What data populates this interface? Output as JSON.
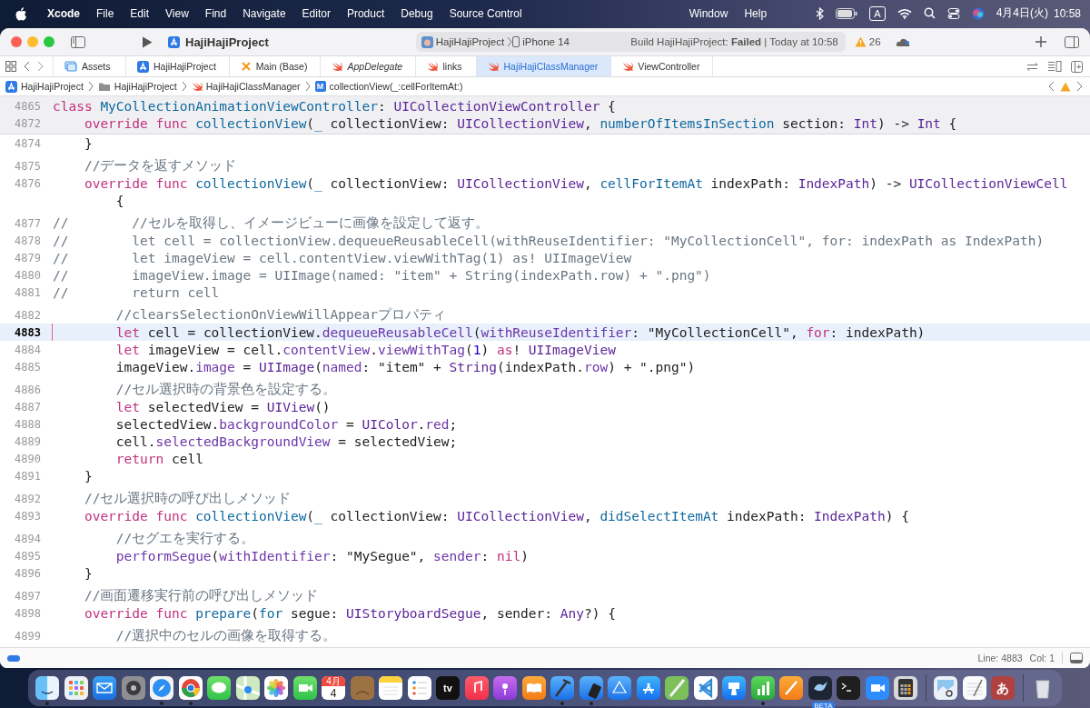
{
  "menu_bar": {
    "app": "Xcode",
    "menus": [
      "File",
      "Edit",
      "View",
      "Find",
      "Navigate",
      "Editor",
      "Product",
      "Debug",
      "Source Control"
    ],
    "menus_past_notch": [
      "Window",
      "Help"
    ],
    "input_source": "A",
    "date": "4月4日(火)",
    "time": "10:58"
  },
  "toolbar": {
    "project": "HajiHajiProject",
    "scheme": "HajiHajiProject",
    "device": "iPhone 14",
    "build_status": "Build HajiHajiProject: **Failed** | Today at 10:58",
    "warnings": "26"
  },
  "tabs": [
    {
      "label": "Assets",
      "kind": "assets",
      "selected": false,
      "preview": false
    },
    {
      "label": "HajiHajiProject",
      "kind": "project",
      "selected": false,
      "preview": false
    },
    {
      "label": "Main (Base)",
      "kind": "storyboard",
      "selected": false,
      "preview": false
    },
    {
      "label": "AppDelegate",
      "kind": "swift",
      "selected": false,
      "preview": true
    },
    {
      "label": "links",
      "kind": "swift",
      "selected": false,
      "preview": false
    },
    {
      "label": "HajiHajiClassManager",
      "kind": "swift",
      "selected": true,
      "preview": false
    },
    {
      "label": "ViewController",
      "kind": "swift",
      "selected": false,
      "preview": false
    }
  ],
  "breadcrumb": [
    {
      "label": "HajiHajiProject",
      "kind": "project"
    },
    {
      "label": "HajiHajiProject",
      "kind": "folder"
    },
    {
      "label": "HajiHajiClassManager",
      "kind": "swift"
    },
    {
      "label": "collectionView(_:cellForItemAt:)",
      "kind": "method",
      "badge": "M"
    }
  ],
  "editor": {
    "sticky_lines": [
      {
        "number": "4865",
        "tokens": [
          {
            "kind": "kw",
            "text": "class "
          },
          {
            "kind": "decl",
            "text": "MyCollectionAnimationViewController"
          },
          {
            "kind": "plain",
            "text": ": "
          },
          {
            "kind": "type",
            "text": "UICollectionViewController"
          },
          {
            "kind": "plain",
            "text": " {"
          }
        ]
      },
      {
        "number": "4872",
        "tokens": [
          {
            "kind": "kw",
            "text": "    override func "
          },
          {
            "kind": "decl",
            "text": "collectionView"
          },
          {
            "kind": "plain",
            "text": "("
          },
          {
            "kind": "decl",
            "text": "_"
          },
          {
            "kind": "plain",
            "text": " collectionView: "
          },
          {
            "kind": "type",
            "text": "UICollectionView"
          },
          {
            "kind": "plain",
            "text": ", "
          },
          {
            "kind": "decl",
            "text": "numberOfItemsInSection"
          },
          {
            "kind": "plain",
            "text": " section: "
          },
          {
            "kind": "type",
            "text": "Int"
          },
          {
            "kind": "plain",
            "text": ") -> "
          },
          {
            "kind": "type",
            "text": "Int"
          },
          {
            "kind": "plain",
            "text": " {"
          }
        ]
      }
    ],
    "blocks": [
      {
        "lines": [
          {
            "number": "4874",
            "current": false,
            "tokens": [
              {
                "kind": "plain",
                "text": "    }"
              }
            ]
          }
        ]
      },
      {
        "lines": [
          {
            "number": "4875",
            "current": false,
            "tokens": [
              {
                "kind": "com",
                "text": "    //データを返すメソッド"
              }
            ]
          },
          {
            "number": "4876",
            "current": false,
            "tokens": [
              {
                "kind": "kw",
                "text": "    override func "
              },
              {
                "kind": "decl",
                "text": "collectionView"
              },
              {
                "kind": "plain",
                "text": "("
              },
              {
                "kind": "decl",
                "text": "_"
              },
              {
                "kind": "plain",
                "text": " collectionView: "
              },
              {
                "kind": "type",
                "text": "UICollectionView"
              },
              {
                "kind": "plain",
                "text": ", "
              },
              {
                "kind": "decl",
                "text": "cellForItemAt"
              },
              {
                "kind": "plain",
                "text": " indexPath: "
              },
              {
                "kind": "type",
                "text": "IndexPath"
              },
              {
                "kind": "plain",
                "text": ") -> "
              },
              {
                "kind": "type",
                "text": "UICollectionViewCell"
              }
            ],
            "wrap": [
              {
                "kind": "plain",
                "text": "        {"
              }
            ]
          }
        ]
      },
      {
        "lines": [
          {
            "number": "4877",
            "current": false,
            "tokens": [
              {
                "kind": "com",
                "text": "//        //セルを取得し、イメージビューに画像を設定して返す。"
              }
            ]
          },
          {
            "number": "4878",
            "current": false,
            "tokens": [
              {
                "kind": "com",
                "text": "//        let cell = collectionView.dequeueReusableCell(withReuseIdentifier: \"MyCollectionCell\", for: indexPath as IndexPath)"
              }
            ]
          },
          {
            "number": "4879",
            "current": false,
            "tokens": [
              {
                "kind": "com",
                "text": "//        let imageView = cell.contentView.viewWithTag(1) as! UIImageView"
              }
            ]
          },
          {
            "number": "4880",
            "current": false,
            "tokens": [
              {
                "kind": "com",
                "text": "//        imageView.image = UIImage(named: \"item\" + String(indexPath.row) + \".png\")"
              }
            ]
          },
          {
            "number": "4881",
            "current": false,
            "tokens": [
              {
                "kind": "com",
                "text": "//        return cell"
              }
            ]
          }
        ]
      },
      {
        "lines": [
          {
            "number": "4882",
            "current": false,
            "tokens": [
              {
                "kind": "com",
                "text": "        //clearsSelectionOnViewWillAppearプロパティ"
              }
            ]
          },
          {
            "number": "4883",
            "current": true,
            "tokens": [
              {
                "kind": "kw",
                "text": "        let"
              },
              {
                "kind": "plain",
                "text": " cell = collectionView."
              },
              {
                "kind": "mem",
                "text": "dequeueReusableCell"
              },
              {
                "kind": "plain",
                "text": "("
              },
              {
                "kind": "mem",
                "text": "withReuseIdentifier"
              },
              {
                "kind": "plain",
                "text": ": \"MyCollectionCell\", "
              },
              {
                "kind": "kw",
                "text": "for"
              },
              {
                "kind": "plain",
                "text": ": indexPath)"
              }
            ]
          },
          {
            "number": "4884",
            "current": false,
            "tokens": [
              {
                "kind": "kw",
                "text": "        let"
              },
              {
                "kind": "plain",
                "text": " imageView = cell."
              },
              {
                "kind": "mem",
                "text": "contentView"
              },
              {
                "kind": "plain",
                "text": "."
              },
              {
                "kind": "mem",
                "text": "viewWithTag"
              },
              {
                "kind": "plain",
                "text": "("
              },
              {
                "kind": "num",
                "text": "1"
              },
              {
                "kind": "plain",
                "text": ") "
              },
              {
                "kind": "kw",
                "text": "as"
              },
              {
                "kind": "plain",
                "text": "! "
              },
              {
                "kind": "type",
                "text": "UIImageView"
              }
            ]
          },
          {
            "number": "4885",
            "current": false,
            "tokens": [
              {
                "kind": "plain",
                "text": "        imageView."
              },
              {
                "kind": "mem",
                "text": "image"
              },
              {
                "kind": "plain",
                "text": " = "
              },
              {
                "kind": "type",
                "text": "UIImage"
              },
              {
                "kind": "plain",
                "text": "("
              },
              {
                "kind": "mem",
                "text": "named"
              },
              {
                "kind": "plain",
                "text": ": \"item\" + "
              },
              {
                "kind": "type",
                "text": "String"
              },
              {
                "kind": "plain",
                "text": "(indexPath."
              },
              {
                "kind": "mem",
                "text": "row"
              },
              {
                "kind": "plain",
                "text": ") + \".png\")"
              }
            ]
          }
        ]
      },
      {
        "lines": [
          {
            "number": "4886",
            "current": false,
            "tokens": [
              {
                "kind": "com",
                "text": "        //セル選択時の背景色を設定する。"
              }
            ]
          },
          {
            "number": "4887",
            "current": false,
            "tokens": [
              {
                "kind": "kw",
                "text": "        let"
              },
              {
                "kind": "plain",
                "text": " selectedView = "
              },
              {
                "kind": "type",
                "text": "UIView"
              },
              {
                "kind": "plain",
                "text": "()"
              }
            ]
          },
          {
            "number": "4888",
            "current": false,
            "tokens": [
              {
                "kind": "plain",
                "text": "        selectedView."
              },
              {
                "kind": "mem",
                "text": "backgroundColor"
              },
              {
                "kind": "plain",
                "text": " = "
              },
              {
                "kind": "type",
                "text": "UIColor"
              },
              {
                "kind": "plain",
                "text": "."
              },
              {
                "kind": "mem",
                "text": "red"
              },
              {
                "kind": "plain",
                "text": ";"
              }
            ]
          },
          {
            "number": "4889",
            "current": false,
            "tokens": [
              {
                "kind": "plain",
                "text": "        cell."
              },
              {
                "kind": "mem",
                "text": "selectedBackgroundView"
              },
              {
                "kind": "plain",
                "text": " = selectedView;"
              }
            ]
          },
          {
            "number": "4890",
            "current": false,
            "tokens": [
              {
                "kind": "kw",
                "text": "        return"
              },
              {
                "kind": "plain",
                "text": " cell"
              }
            ]
          },
          {
            "number": "4891",
            "current": false,
            "tokens": [
              {
                "kind": "plain",
                "text": "    }"
              }
            ]
          }
        ]
      },
      {
        "lines": [
          {
            "number": "4892",
            "current": false,
            "tokens": [
              {
                "kind": "com",
                "text": "    //セル選択時の呼び出しメソッド"
              }
            ]
          },
          {
            "number": "4893",
            "current": false,
            "tokens": [
              {
                "kind": "kw",
                "text": "    override func "
              },
              {
                "kind": "decl",
                "text": "collectionView"
              },
              {
                "kind": "plain",
                "text": "("
              },
              {
                "kind": "decl",
                "text": "_"
              },
              {
                "kind": "plain",
                "text": " collectionView: "
              },
              {
                "kind": "type",
                "text": "UICollectionView"
              },
              {
                "kind": "plain",
                "text": ", "
              },
              {
                "kind": "decl",
                "text": "didSelectItemAt"
              },
              {
                "kind": "plain",
                "text": " indexPath: "
              },
              {
                "kind": "type",
                "text": "IndexPath"
              },
              {
                "kind": "plain",
                "text": ") {"
              }
            ]
          }
        ]
      },
      {
        "lines": [
          {
            "number": "4894",
            "current": false,
            "tokens": [
              {
                "kind": "com",
                "text": "        //セグエを実行する。"
              }
            ]
          },
          {
            "number": "4895",
            "current": false,
            "tokens": [
              {
                "kind": "mem",
                "text": "        performSegue"
              },
              {
                "kind": "plain",
                "text": "("
              },
              {
                "kind": "mem",
                "text": "withIdentifier"
              },
              {
                "kind": "plain",
                "text": ": \"MySegue\", "
              },
              {
                "kind": "mem",
                "text": "sender"
              },
              {
                "kind": "plain",
                "text": ": "
              },
              {
                "kind": "kw",
                "text": "nil"
              },
              {
                "kind": "plain",
                "text": ")"
              }
            ]
          },
          {
            "number": "4896",
            "current": false,
            "tokens": [
              {
                "kind": "plain",
                "text": "    }"
              }
            ]
          }
        ]
      },
      {
        "lines": [
          {
            "number": "4897",
            "current": false,
            "tokens": [
              {
                "kind": "com",
                "text": "    //画面遷移実行前の呼び出しメソッド"
              }
            ]
          },
          {
            "number": "4898",
            "current": false,
            "tokens": [
              {
                "kind": "kw",
                "text": "    override func "
              },
              {
                "kind": "decl",
                "text": "prepare"
              },
              {
                "kind": "plain",
                "text": "("
              },
              {
                "kind": "decl",
                "text": "for"
              },
              {
                "kind": "plain",
                "text": " segue: "
              },
              {
                "kind": "type",
                "text": "UIStoryboardSegue"
              },
              {
                "kind": "plain",
                "text": ", sender: "
              },
              {
                "kind": "type",
                "text": "Any"
              },
              {
                "kind": "plain",
                "text": "?) {"
              }
            ]
          }
        ]
      },
      {
        "lines": [
          {
            "number": "4899",
            "current": false,
            "tokens": [
              {
                "kind": "com",
                "text": "        //選択中のセルの画像を取得する。"
              }
            ]
          }
        ]
      }
    ]
  },
  "status_bar": {
    "line": "Line: 4883",
    "column": "Col: 1"
  },
  "dock": [
    {
      "kind": "finder",
      "running": true
    },
    {
      "kind": "launchpad",
      "running": false
    },
    {
      "kind": "mail",
      "running": false
    },
    {
      "kind": "settings",
      "running": false
    },
    {
      "kind": "safari",
      "running": true
    },
    {
      "kind": "chrome",
      "running": true
    },
    {
      "kind": "messages",
      "running": false
    },
    {
      "kind": "maps",
      "running": false
    },
    {
      "kind": "photos",
      "running": false
    },
    {
      "kind": "facetime",
      "running": false
    },
    {
      "kind": "calendar",
      "month": "4月",
      "day": "4",
      "running": false
    },
    {
      "kind": "notebook",
      "running": false
    },
    {
      "kind": "notes",
      "running": false
    },
    {
      "kind": "reminders",
      "running": false
    },
    {
      "kind": "tv",
      "label": "tv",
      "running": false
    },
    {
      "kind": "music",
      "running": false
    },
    {
      "kind": "podcasts",
      "running": false
    },
    {
      "kind": "books",
      "running": false
    },
    {
      "kind": "xcode",
      "running": true
    },
    {
      "kind": "simulator",
      "running": true
    },
    {
      "kind": "reality",
      "running": false
    },
    {
      "kind": "appstore",
      "running": false
    },
    {
      "kind": "drawmap",
      "running": false
    },
    {
      "kind": "vscode",
      "running": false
    },
    {
      "kind": "keynote",
      "running": false
    },
    {
      "kind": "numbers",
      "running": true
    },
    {
      "kind": "pages",
      "running": false
    },
    {
      "kind": "playgrounds",
      "badge": "BETA",
      "running": false
    },
    {
      "kind": "terminal",
      "running": false
    },
    {
      "kind": "zoom",
      "running": false
    },
    {
      "kind": "calculator",
      "running": false
    },
    {
      "kind": "separator"
    },
    {
      "kind": "preview",
      "running": false
    },
    {
      "kind": "textedit",
      "running": false
    },
    {
      "kind": "kotoeri",
      "label": "あ",
      "running": false
    },
    {
      "kind": "separator"
    },
    {
      "kind": "trash",
      "running": false
    }
  ]
}
